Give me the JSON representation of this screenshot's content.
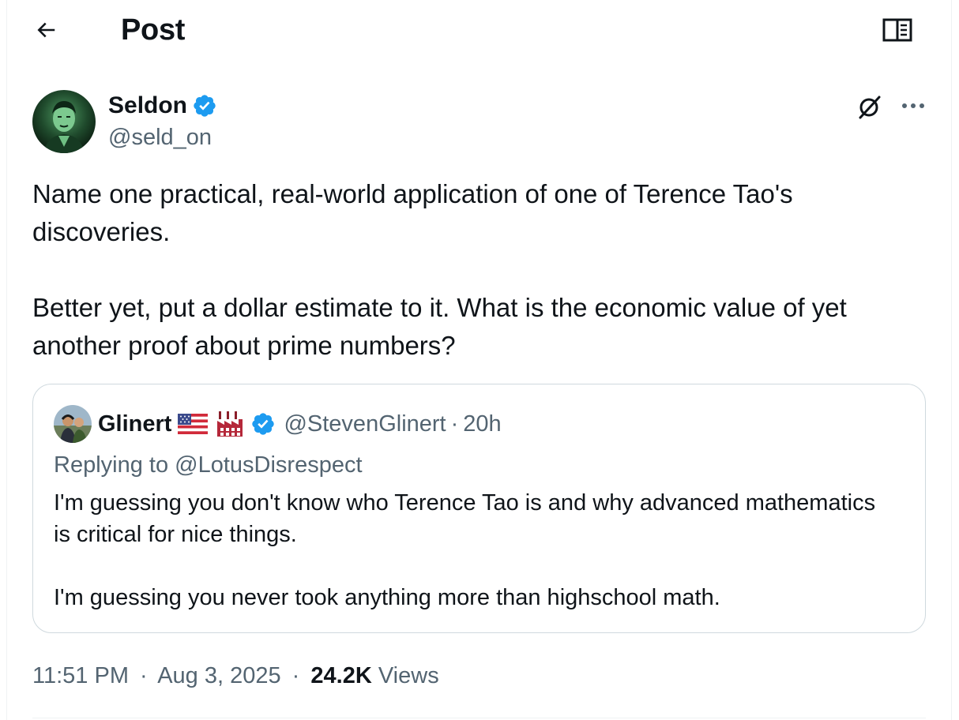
{
  "header": {
    "title": "Post",
    "back_icon": "arrow-left-icon",
    "reader_icon": "open-book-icon"
  },
  "post": {
    "author": {
      "name": "Seldon",
      "handle": "@seld_on",
      "verified": true
    },
    "paragraphs": [
      "Name one practical, real-world application of one of Terence Tao's discoveries.",
      "Better yet, put a dollar estimate to it. What is the economic value of yet another proof about prime numbers?"
    ],
    "time": "11:51 PM",
    "date": "Aug 3, 2025",
    "views_count": "24.2K",
    "views_label": "Views",
    "separator": "·"
  },
  "quote": {
    "name": "Glinert",
    "flag_icon": "us-flag-icon",
    "factory_icon": "factory-icon",
    "verified": true,
    "handle": "@StevenGlinert",
    "separator": "·",
    "time": "20h",
    "replying_prefix": "Replying to",
    "replying_to": "@LotusDisrespect",
    "paragraphs": [
      "I'm guessing you don't know who Terence Tao is and why advanced mathematics is critical for nice things.",
      "I'm guessing you never took anything more than highschool math."
    ]
  },
  "colors": {
    "text": "#0f1419",
    "secondary": "#536471",
    "verified_blue": "#1d9bf0",
    "border": "#cfd9de"
  }
}
